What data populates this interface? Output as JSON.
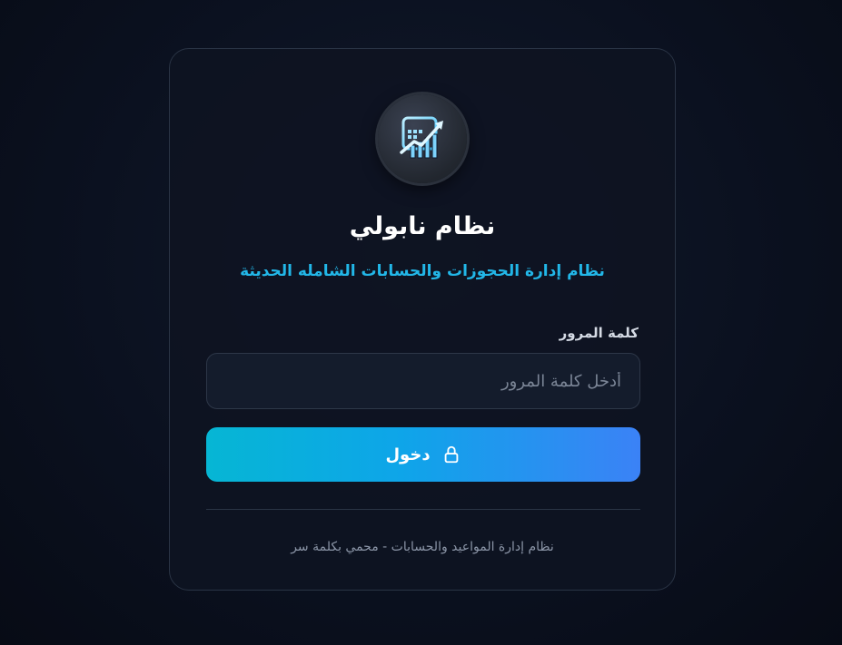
{
  "app": {
    "title": "نظام نابولي",
    "subtitle": "نظام إدارة الحجوزات والحسابات الشامله الحديثة"
  },
  "logo": {
    "icon": "calendar-growth-chart-icon"
  },
  "form": {
    "password_label": "كلمة المرور",
    "password_placeholder": "أدخل كلمة المرور",
    "password_value": "",
    "submit_label": "دخول",
    "submit_icon": "lock-icon"
  },
  "footer": {
    "text": "نظام إدارة المواعيد والحسابات - محمي بكلمة سر"
  },
  "colors": {
    "accent": "#22b7e8",
    "button_start": "#06b6d4",
    "button_end": "#3b82f6",
    "background": "#0b1120"
  }
}
